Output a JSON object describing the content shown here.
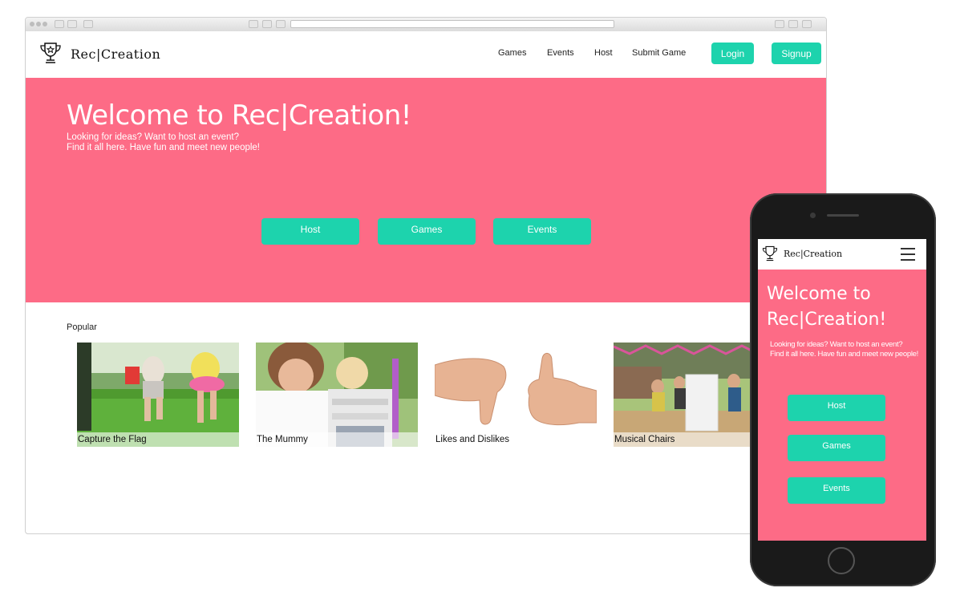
{
  "brand": {
    "name": "Rec|Creation"
  },
  "nav": {
    "links": [
      "Games",
      "Events",
      "Host",
      "Submit Game"
    ],
    "login": "Login",
    "signup": "Signup"
  },
  "hero": {
    "title": "Welcome to Rec|Creation!",
    "subtitle_line1": "Looking for ideas? Want to host an event?",
    "subtitle_line2": "Find it all here. Have fun and meet new people!",
    "buttons": [
      "Host",
      "Games",
      "Events"
    ]
  },
  "popular": {
    "label": "Popular",
    "cards": [
      {
        "title": "Capture the Flag"
      },
      {
        "title": "The Mummy"
      },
      {
        "title": "Likes and Dislikes"
      },
      {
        "title": "Musical Chairs"
      }
    ]
  },
  "mobile": {
    "title_line1": "Welcome to",
    "title_line2": "Rec|Creation!",
    "subtitle_line1": "Looking for ideas? Want to host an event?",
    "subtitle_line2": "Find it all here. Have fun and meet new people!",
    "buttons": [
      "Host",
      "Games",
      "Events"
    ]
  },
  "colors": {
    "hero": "#fd6b86",
    "accent": "#1dd3ad"
  },
  "icons": {
    "logo": "trophy-icon",
    "menu": "hamburger-menu-icon"
  }
}
